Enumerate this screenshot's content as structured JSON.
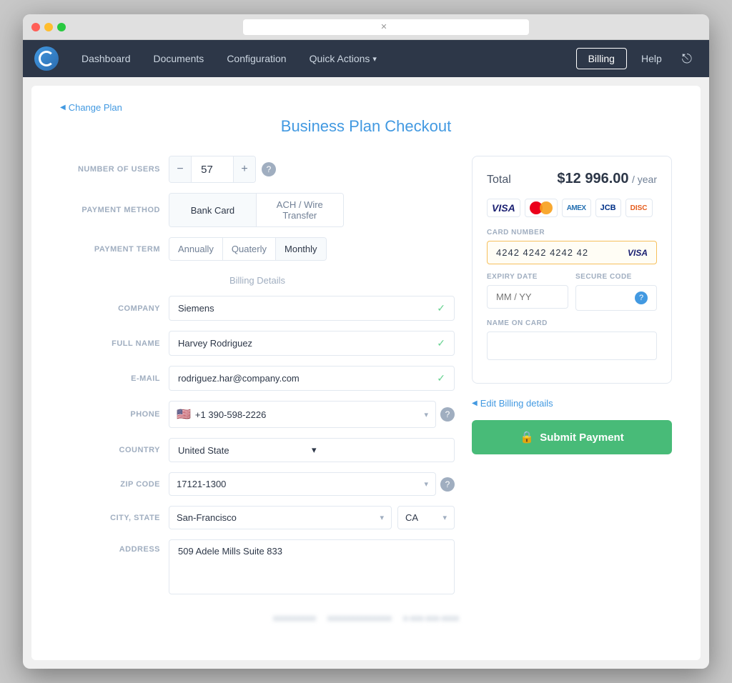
{
  "window": {
    "title": "Business Plan Checkout"
  },
  "nav": {
    "dashboard": "Dashboard",
    "documents": "Documents",
    "configuration": "Configuration",
    "quick_actions": "Quick Actions",
    "billing": "Billing",
    "help": "Help"
  },
  "back": "Change Plan",
  "page_title": "Business Plan Checkout",
  "form": {
    "users_label": "NUMBER OF USERS",
    "users_value": "57",
    "payment_method_label": "PAYMENT METHOD",
    "payment_method_bank": "Bank Card",
    "payment_method_ach": "ACH / Wire Transfer",
    "payment_term_label": "PAYMENT TERM",
    "payment_term_annually": "Annually",
    "payment_term_quarterly": "Quaterly",
    "payment_term_monthly": "Monthly",
    "billing_section": "Billing Details",
    "company_label": "COMPANY",
    "company_value": "Siemens",
    "fullname_label": "FULL NAME",
    "fullname_value": "Harvey Rodriguez",
    "email_label": "E-MAIL",
    "email_value": "rodriguez.har@company.com",
    "phone_label": "PHONE",
    "phone_value": "+1 390-598-2226",
    "country_label": "COUNTRY",
    "country_value": "United State",
    "zip_label": "ZIP CODE",
    "zip_value": "17121-1300",
    "city_state_label": "CITY, STATE",
    "city_value": "San-Francisco",
    "state_value": "CA",
    "address_label": "ADDRESS",
    "address_value": "509 Adele Mills Suite 833"
  },
  "payment": {
    "total_label": "Total",
    "total_amount": "$12 996.00",
    "total_period": "/ year",
    "card_number_label": "CARD NUMBER",
    "card_number_value": "4242 4242 4242 42",
    "expiry_label": "EXPIRY DATE",
    "expiry_placeholder": "MM / YY",
    "secure_label": "SECURE CODE",
    "name_label": "NAME ON CARD",
    "edit_billing": "Edit Billing details",
    "submit": "Submit Payment"
  },
  "footer": {
    "item1": "xxxxxxxxxx",
    "item2": "xxxxxxxxxxxxxxx",
    "item3": "x-xxx-xxx-xxxx"
  }
}
